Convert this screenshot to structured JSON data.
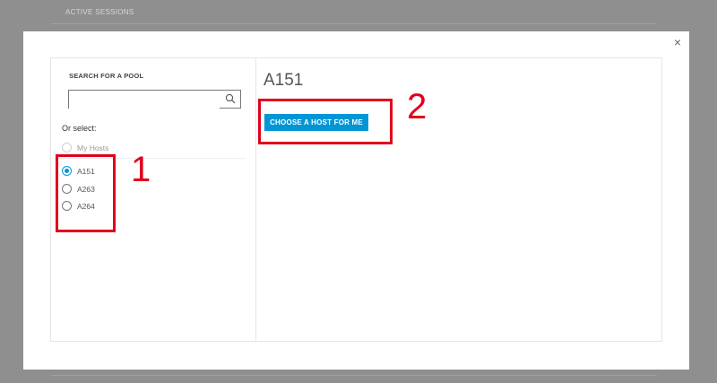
{
  "background": {
    "header_label": "ACTIVE SESSIONS"
  },
  "modal": {
    "close_glyph": "×",
    "search": {
      "label": "SEARCH FOR A POOL",
      "value": "",
      "placeholder": ""
    },
    "or_select_label": "Or select:",
    "my_hosts": {
      "label": "My Hosts",
      "disabled": true
    },
    "pools": [
      {
        "label": "A151",
        "checked": true
      },
      {
        "label": "A263",
        "checked": false
      },
      {
        "label": "A264",
        "checked": false
      }
    ],
    "selected_pool_title": "A151",
    "choose_button_label": "CHOOSE A HOST FOR ME"
  },
  "annotations": {
    "label_1": "1",
    "label_2": "2",
    "color": "#e0001b"
  },
  "colors": {
    "accent": "#0096d6",
    "overlay": "#8f8f8f"
  }
}
